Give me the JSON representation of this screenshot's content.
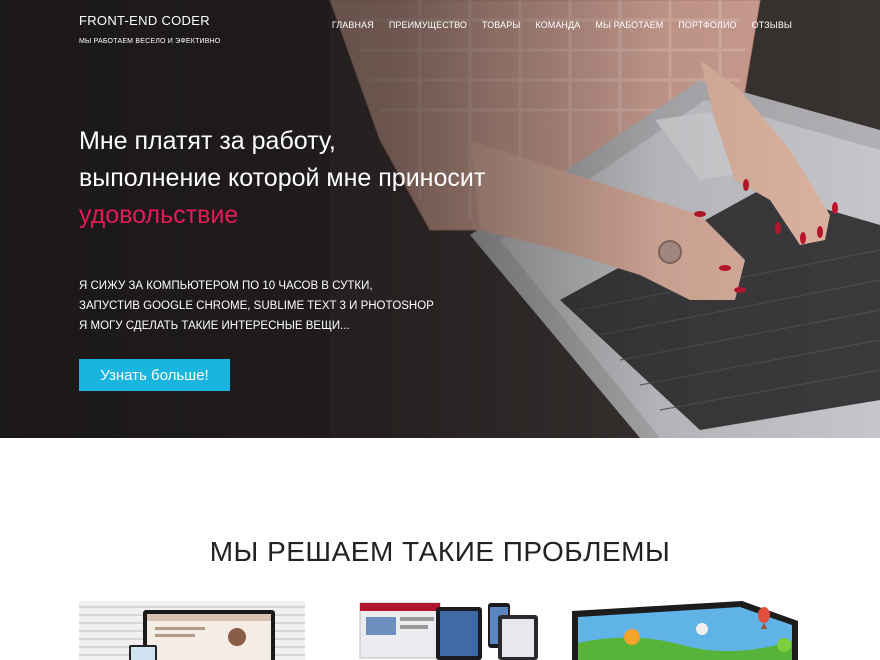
{
  "header": {
    "logo_title": "FRONT-END CODER",
    "logo_tagline": "МЫ РАБОТАЕМ ВЕСЕЛО И ЭФЕКТИВНО"
  },
  "nav": {
    "items": [
      {
        "label": "ГЛАВНАЯ"
      },
      {
        "label": "ПРЕИМУЩЕСТВО"
      },
      {
        "label": "ТОВАРЫ"
      },
      {
        "label": "КОМАНДА"
      },
      {
        "label": "МЫ РАБОТАЕМ"
      },
      {
        "label": "ПОРТФОЛИО"
      },
      {
        "label": "ОТЗЫВЫ"
      }
    ]
  },
  "hero": {
    "headline_line1": "Мне платят за работу,",
    "headline_line2": "выполнение которой мне приносит",
    "headline_accent": "удовольствие",
    "sub_line1": "Я СИЖУ ЗА КОМПЬЮТЕРОМ ПО 10 ЧАСОВ В СУТКИ,",
    "sub_line2": "ЗАПУСТИВ GOOGLE CHROME, SUBLIME TEXT 3 И PHOTOSHOP",
    "sub_line3": "Я МОГУ СДЕЛАТЬ ТАКИЕ ИНТЕРЕСНЫЕ ВЕЩИ...",
    "cta_label": "Узнать больше!"
  },
  "problems": {
    "title": "МЫ РЕШАЕМ ТАКИЕ ПРОБЛЕМЫ"
  },
  "colors": {
    "accent_pink": "#e6195a",
    "cta_blue": "#19b5de"
  }
}
